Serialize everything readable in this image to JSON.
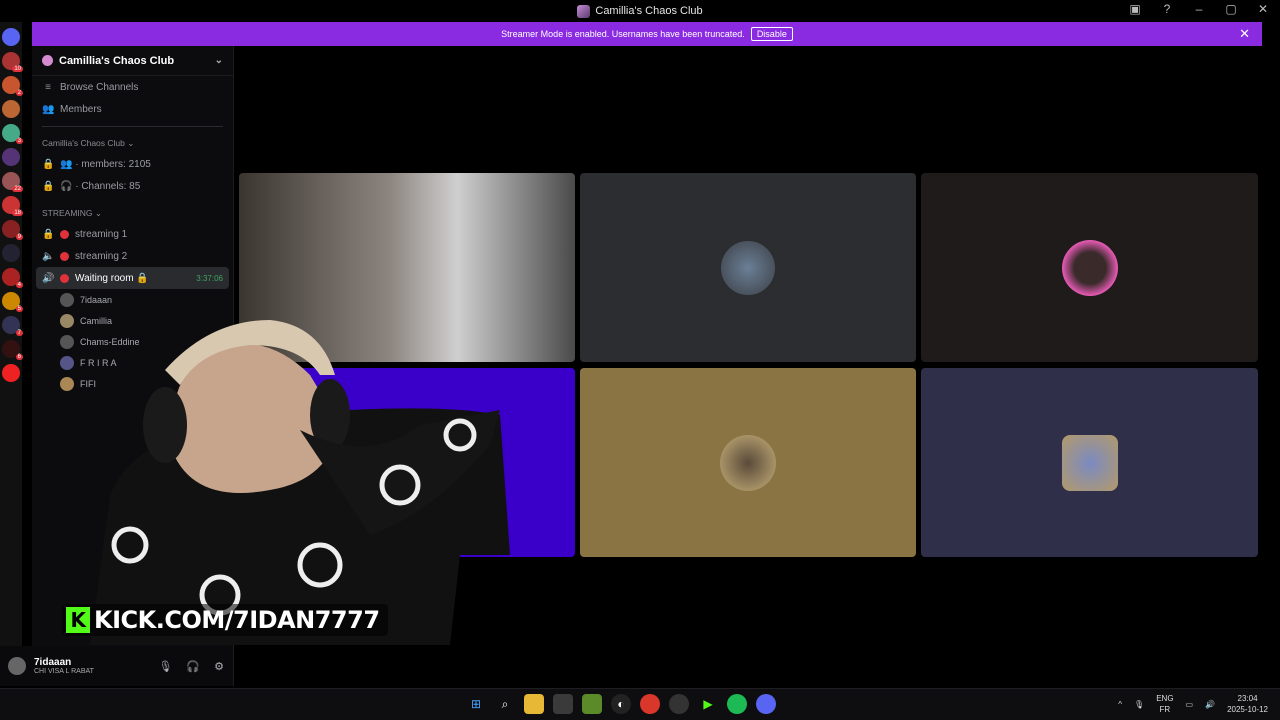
{
  "window": {
    "title": "Camillia's Chaos Club"
  },
  "banner": {
    "message": "Streamer Mode is enabled. Usernames have been truncated.",
    "disable_label": "Disable",
    "close": "✕"
  },
  "sidebar": {
    "server_name": "Camillia's Chaos Club",
    "top_items": [
      {
        "icon": "≡",
        "label": "Browse Channels"
      },
      {
        "icon": "👥",
        "label": "Members"
      }
    ],
    "category1": "Camillia's Chaos Club ⌄",
    "stats": [
      {
        "label": "👥 · members: 2105"
      },
      {
        "label": "🎧 · Channels: 85"
      }
    ],
    "category2": "STREAMING ⌄",
    "streaming": [
      "streaming 1",
      "streaming 2"
    ],
    "active_channel": {
      "label": "Waiting room 🔒",
      "time": "3:37:06"
    },
    "voice_users": [
      "7idaaan",
      "Camillia",
      "Chams-Eddine",
      "F R I R A",
      "FIFI"
    ]
  },
  "user_panel": {
    "name": "7idaaan",
    "status": "CHI VISA L RABAT"
  },
  "overlay": {
    "kick_text": "KICK.COM/7IDAN7777",
    "kick_logo": "K"
  },
  "taskbar": {
    "lang1": "ENG",
    "lang2": "FR",
    "time": "23:04",
    "date": "2025-10-12"
  },
  "colors": {
    "banner": "#8a2be2",
    "tile_dark": "#2b2d31",
    "tile_gold": "#8a7443",
    "tile_blue_dark": "#2f2f4a",
    "tile_purple": "#3a00c9",
    "kick_green": "#53fc18"
  }
}
